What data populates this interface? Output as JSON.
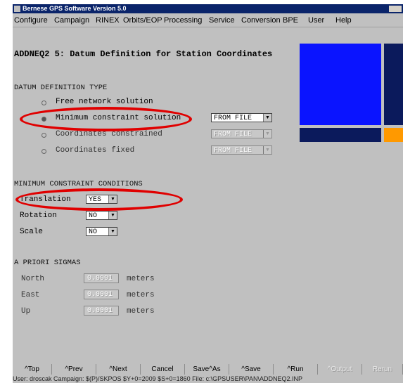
{
  "window": {
    "title": "Bernese GPS Software Version 5.0"
  },
  "menu": [
    "Configure",
    "Campaign",
    "RINEX",
    "Orbits/EOP",
    "Processing",
    "Service",
    "Conversion",
    "BPE",
    "User",
    "Help"
  ],
  "panel": {
    "title": "ADDNEQ2 5: Datum Definition for Station Coordinates",
    "datum_section": "DATUM DEFINITION TYPE",
    "options": [
      {
        "label": "Free network solution",
        "selected": false
      },
      {
        "label": "Minimum constraint solution",
        "selected": true,
        "combo": "FROM FILE",
        "enabled": true
      },
      {
        "label": "Coordinates constrained",
        "selected": false,
        "combo": "FROM FILE",
        "enabled": false
      },
      {
        "label": "Coordinates fixed",
        "selected": false,
        "combo": "FROM FILE",
        "enabled": false
      }
    ],
    "min_section": "MINIMUM CONSTRAINT CONDITIONS",
    "conditions": [
      {
        "label": "Translation",
        "value": "YES"
      },
      {
        "label": "Rotation",
        "value": "NO"
      },
      {
        "label": "Scale",
        "value": "NO"
      }
    ],
    "sigmas_section": "A PRIORI SIGMAS",
    "sigmas": [
      {
        "label": "North",
        "value": "0.0001",
        "unit": "meters"
      },
      {
        "label": "East",
        "value": "0.0001",
        "unit": "meters"
      },
      {
        "label": "Up",
        "value": "0.0001",
        "unit": "meters"
      }
    ]
  },
  "colors": {
    "logo_blue": "#0a14ff",
    "logo_navy": "#0b1a5c",
    "logo_orange": "#ff9900",
    "highlight": "#e00000"
  },
  "toolbar": [
    {
      "label": "^Top",
      "enabled": true
    },
    {
      "label": "^Prev",
      "enabled": true
    },
    {
      "label": "^Next",
      "enabled": true
    },
    {
      "label": "Cancel",
      "enabled": true
    },
    {
      "label": "Save^As",
      "enabled": true
    },
    {
      "label": "^Save",
      "enabled": true
    },
    {
      "label": "^Run",
      "enabled": true
    },
    {
      "label": "^Output",
      "enabled": false
    },
    {
      "label": "Rerun",
      "enabled": false
    }
  ],
  "status": "User: droscak  Campaign: $(P)/SKPOS  $Y+0=2009  $S+0=1860  File: c:\\GPSUSER\\PAN\\ADDNEQ2.INP"
}
